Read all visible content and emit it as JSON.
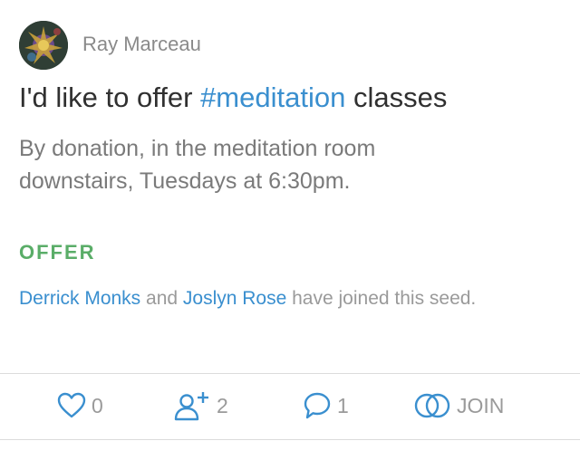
{
  "post": {
    "author": "Ray Marceau",
    "title_prefix": "I'd like to offer ",
    "title_tag": "#meditation",
    "title_suffix": " classes",
    "details": "By donation, in the meditation room downstairs, Tuesdays at 6:30pm.",
    "type_label": "OFFER",
    "joined": {
      "person_1": "Derrick Monks",
      "connector": " and ",
      "person_2": "Joslyn Rose",
      "suffix": " have joined this seed."
    }
  },
  "actions": {
    "likes": "0",
    "followers": "2",
    "comments": "1",
    "join_label": "JOIN"
  },
  "icons": {
    "like": "heart-icon",
    "followers": "person-plus-icon",
    "comments": "speech-bubble-icon",
    "join": "interlocking-rings-icon"
  },
  "colors": {
    "accent": "#3a8fcf",
    "offer": "#5aad68",
    "muted": "#9a9a9a"
  }
}
